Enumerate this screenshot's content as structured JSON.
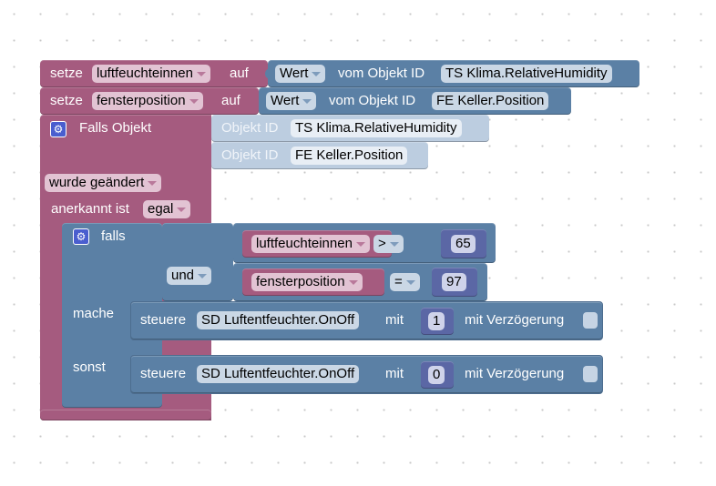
{
  "blocks": {
    "set1": {
      "keyword": "setze",
      "variable": "luftfeuchteinnen",
      "to": "auf",
      "value": {
        "mode": "Wert",
        "from": "vom Objekt ID",
        "object": "TS Klima.RelativeHumidity"
      }
    },
    "set2": {
      "keyword": "setze",
      "variable": "fensterposition",
      "to": "auf",
      "value": {
        "mode": "Wert",
        "from": "vom Objekt ID",
        "object": "FE Keller.Position"
      }
    },
    "trigger": {
      "label": "Falls Objekt",
      "objects": [
        {
          "prefix": "Objekt ID",
          "id": "TS Klima.RelativeHumidity"
        },
        {
          "prefix": "Objekt ID",
          "id": "FE Keller.Position"
        }
      ],
      "condition": "wurde geändert",
      "ack_label": "anerkannt ist",
      "ack_value": "egal"
    },
    "if": {
      "label": "falls",
      "logic_op": "und",
      "compare1": {
        "variable": "luftfeuchteinnen",
        "op": ">",
        "value": "65"
      },
      "compare2": {
        "variable": "fensterposition",
        "op": "=",
        "value": "97"
      },
      "do_label": "mache",
      "else_label": "sonst",
      "do": {
        "keyword": "steuere",
        "object": "SD Luftentfeuchter.OnOff",
        "with": "mit",
        "value": "1",
        "delay_label": "mit Verzögerung",
        "delay_checked": false
      },
      "else": {
        "keyword": "steuere",
        "object": "SD Luftentfeuchter.OnOff",
        "with": "mit",
        "value": "0",
        "delay_label": "mit Verzögerung",
        "delay_checked": false
      }
    }
  },
  "colors": {
    "variables": "#a55b7f",
    "logic": "#5b80a5",
    "math": "#5b67a5",
    "trigger_inputs": "#bccde0"
  }
}
